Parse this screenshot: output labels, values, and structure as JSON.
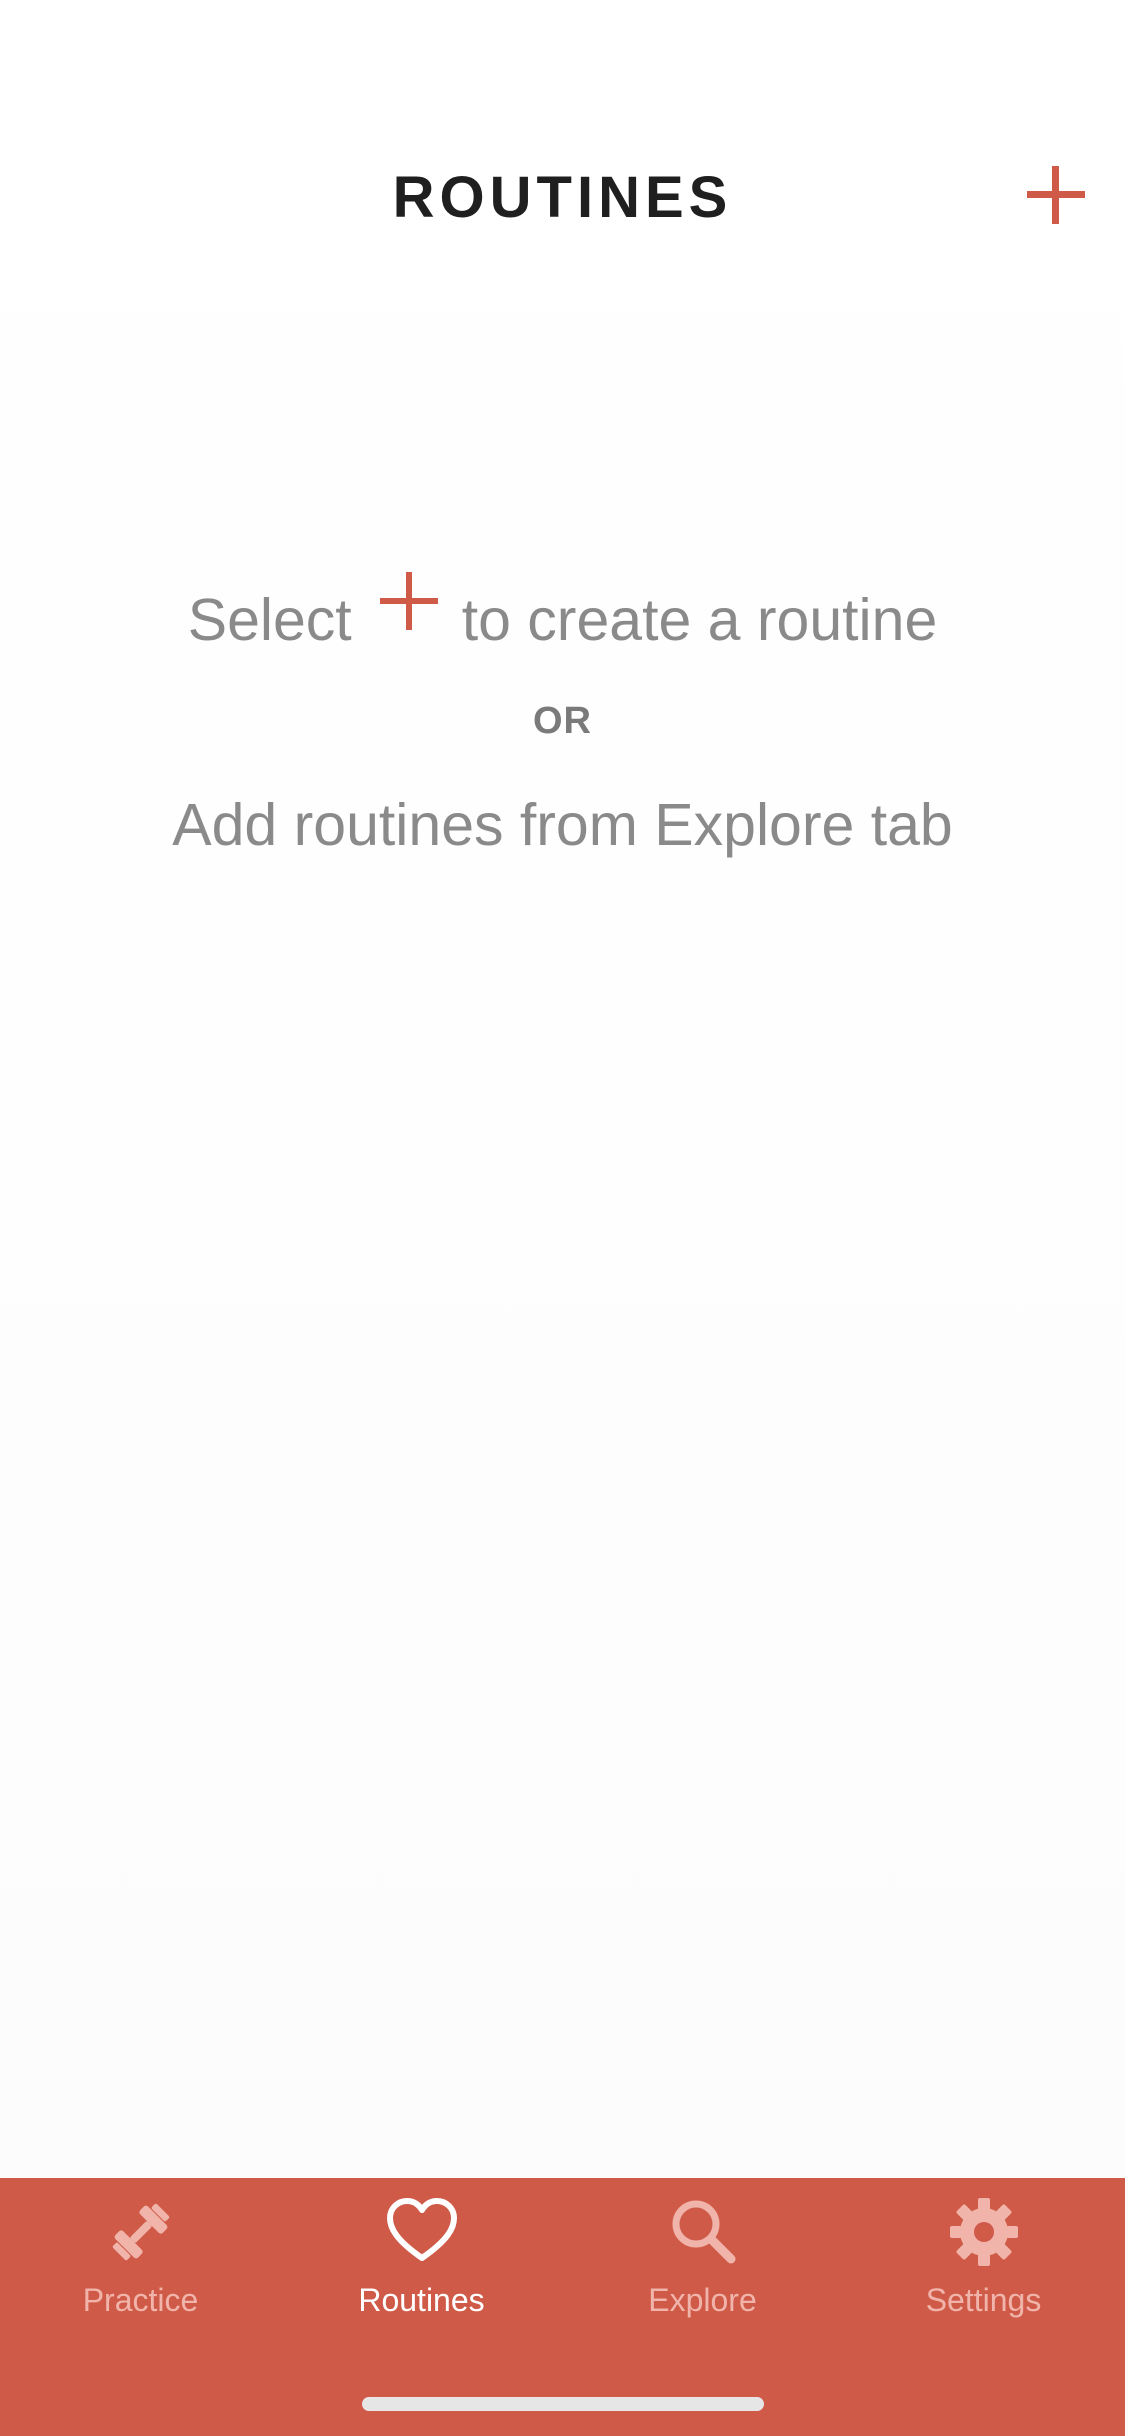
{
  "header": {
    "title": "ROUTINES",
    "add_icon": "plus-icon"
  },
  "empty_state": {
    "line1_before": "Select",
    "line1_after": "to create a routine",
    "or_label": "OR",
    "line2": "Add routines from Explore tab"
  },
  "tabs": [
    {
      "label": "Practice",
      "icon": "dumbbell-icon",
      "active": false
    },
    {
      "label": "Routines",
      "icon": "heart-icon",
      "active": true
    },
    {
      "label": "Explore",
      "icon": "search-icon",
      "active": false
    },
    {
      "label": "Settings",
      "icon": "gear-icon",
      "active": false
    }
  ],
  "colors": {
    "accent": "#d05a48",
    "title": "#1f1f1f",
    "muted_text": "#8a8a8a",
    "tab_inactive": "#f0b4aa",
    "tab_active": "#ffffff"
  }
}
